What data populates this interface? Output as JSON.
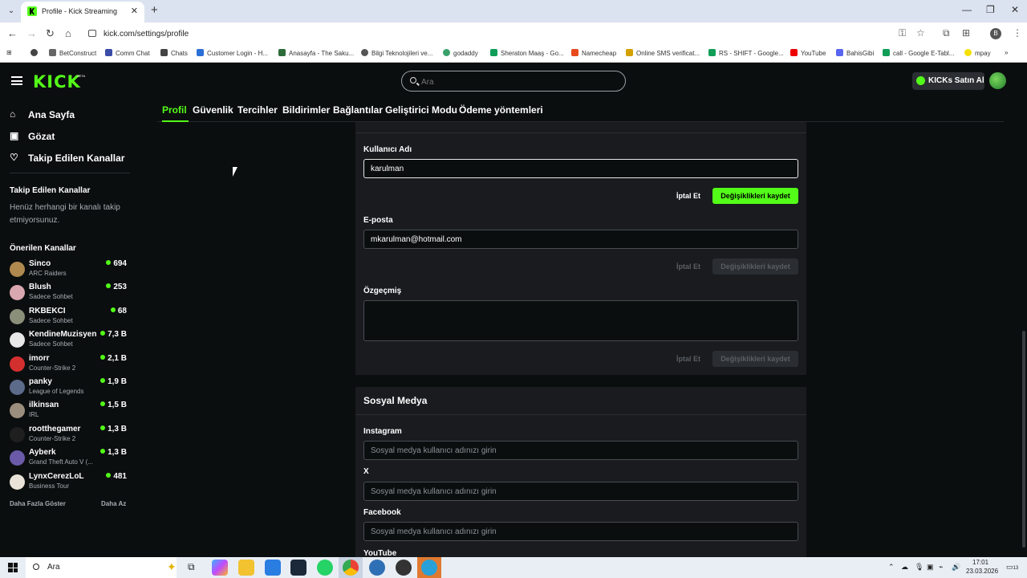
{
  "browser": {
    "tab_title": "Profile - Kick Streaming",
    "url": "kick.com/settings/profile",
    "profile_initial": "B",
    "bookmarks": [
      "BetConstruct",
      "Comm Chat",
      "Chats",
      "Customer Login - H...",
      "Anasayfa - The Saku...",
      "Bilgi Teknolojileri ve...",
      "godaddy",
      "Sheraton Maaş - Go...",
      "Namecheap",
      "Online SMS verificat...",
      "RS - SHIFT - Google...",
      "YouTube",
      "BahisGibi",
      "call - Google E-Tabl...",
      "mpay"
    ]
  },
  "header": {
    "logo": "KICK",
    "logo_badge": "BETA",
    "search_placeholder": "Ara",
    "kicks_button": "KICKs Satın Al"
  },
  "sidebar": {
    "nav": [
      {
        "label": "Ana Sayfa",
        "icon": "home-icon"
      },
      {
        "label": "Gözat",
        "icon": "browse-icon"
      },
      {
        "label": "Takip Edilen Kanallar",
        "icon": "heart-icon"
      }
    ],
    "followed_title": "Takip Edilen Kanallar",
    "followed_empty": "Henüz herhangi bir kanalı takip etmiyorsunuz.",
    "recommended_title": "Önerilen Kanallar",
    "channels": [
      {
        "name": "Sinco",
        "category": "ARC Raiders",
        "viewers": "694",
        "color": "#b0894e"
      },
      {
        "name": "Blush",
        "category": "Sadece Sohbet",
        "viewers": "253",
        "color": "#d9a7b0"
      },
      {
        "name": "RKBEKCI",
        "category": "Sadece Sohbet",
        "viewers": "68",
        "color": "#8a8f7a"
      },
      {
        "name": "KendineMuzisyen",
        "category": "Sadece Sohbet",
        "viewers": "7,3 B",
        "color": "#e8e8e8"
      },
      {
        "name": "imorr",
        "category": "Counter-Strike 2",
        "viewers": "2,1 B",
        "color": "#d42f2f"
      },
      {
        "name": "panky",
        "category": "League of Legends",
        "viewers": "1,9 B",
        "color": "#5d6b8a"
      },
      {
        "name": "ilkinsan",
        "category": "IRL",
        "viewers": "1,5 B",
        "color": "#9c8e7d"
      },
      {
        "name": "rootthegamer",
        "category": "Counter-Strike 2",
        "viewers": "1,3 B",
        "color": "#1f1f1f"
      },
      {
        "name": "Ayberk",
        "category": "Grand Theft Auto V (...",
        "viewers": "1,3 B",
        "color": "#6a5aa8"
      },
      {
        "name": "LynxCerezLoL",
        "category": "Business Tour",
        "viewers": "481",
        "color": "#e8e2d8"
      }
    ],
    "show_more": "Daha Fazla Göster",
    "show_less": "Daha Az"
  },
  "settings_tabs": [
    "Profil",
    "Güvenlik",
    "Tercihler",
    "Bildirimler",
    "Bağlantılar",
    "Geliştirici Modu",
    "Ödeme yöntemleri"
  ],
  "profile": {
    "username_label": "Kullanıcı Adı",
    "username_value": "karulman",
    "email_label": "E-posta",
    "email_value": "mkarulman@hotmail.com",
    "bio_label": "Özgeçmiş",
    "cancel_label": "İptal Et",
    "save_label": "Değişiklikleri kaydet"
  },
  "social": {
    "title": "Sosyal Medya",
    "placeholder": "Sosyal medya kullanıcı adınızı girin",
    "fields": [
      "Instagram",
      "X",
      "Facebook",
      "YouTube"
    ]
  },
  "taskbar": {
    "search_label": "Ara",
    "time": "17:01",
    "date": "23.03.2026",
    "notifications": "13"
  },
  "colors": {
    "accent": "#53fc18",
    "background": "#0b0e0f",
    "card": "#191b1f"
  }
}
